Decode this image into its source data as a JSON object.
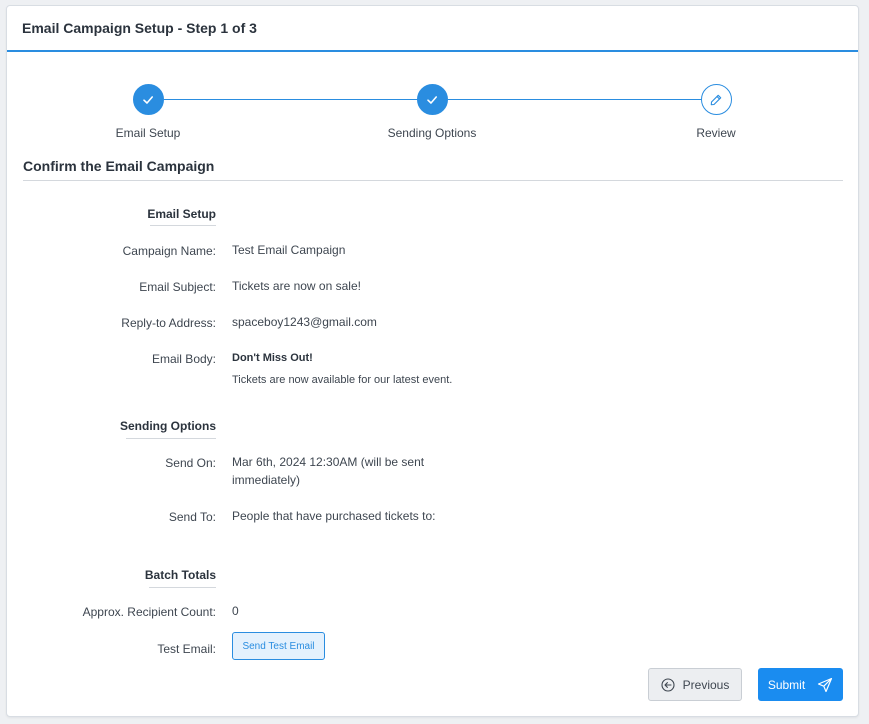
{
  "header": {
    "title": "Email Campaign Setup - Step 1 of 3"
  },
  "stepper": {
    "steps": [
      {
        "label": "Email Setup",
        "state": "done",
        "icon": "check-icon"
      },
      {
        "label": "Sending Options",
        "state": "done",
        "icon": "check-icon"
      },
      {
        "label": "Review",
        "state": "active",
        "icon": "pencil-icon"
      }
    ]
  },
  "section": {
    "title": "Confirm the Email Campaign"
  },
  "email_setup": {
    "heading": "Email Setup",
    "campaign_name_label": "Campaign Name:",
    "campaign_name": "Test Email Campaign",
    "subject_label": "Email Subject:",
    "subject": "Tickets are now on sale!",
    "reply_to_label": "Reply-to Address:",
    "reply_to": "spaceboy1243@gmail.com",
    "body_label": "Email Body:",
    "body_heading": "Don't Miss Out!",
    "body_text": "Tickets are now available for our latest event."
  },
  "sending_options": {
    "heading": "Sending Options",
    "send_on_label": "Send On:",
    "send_on_line1": "Mar 6th, 2024 12:30AM (will be sent",
    "send_on_line2": "immediately)",
    "send_to_label": "Send To:",
    "send_to": "People that have purchased tickets to:"
  },
  "batch_totals": {
    "heading": "Batch Totals",
    "recipient_label": "Approx. Recipient Count:",
    "recipient_count": "0",
    "test_email_label": "Test Email:",
    "test_email_button": "Send Test Email"
  },
  "footer": {
    "previous_label": "Previous",
    "submit_label": "Submit"
  },
  "colors": {
    "accent": "#2a8de0",
    "submit": "#1a8cf0"
  }
}
